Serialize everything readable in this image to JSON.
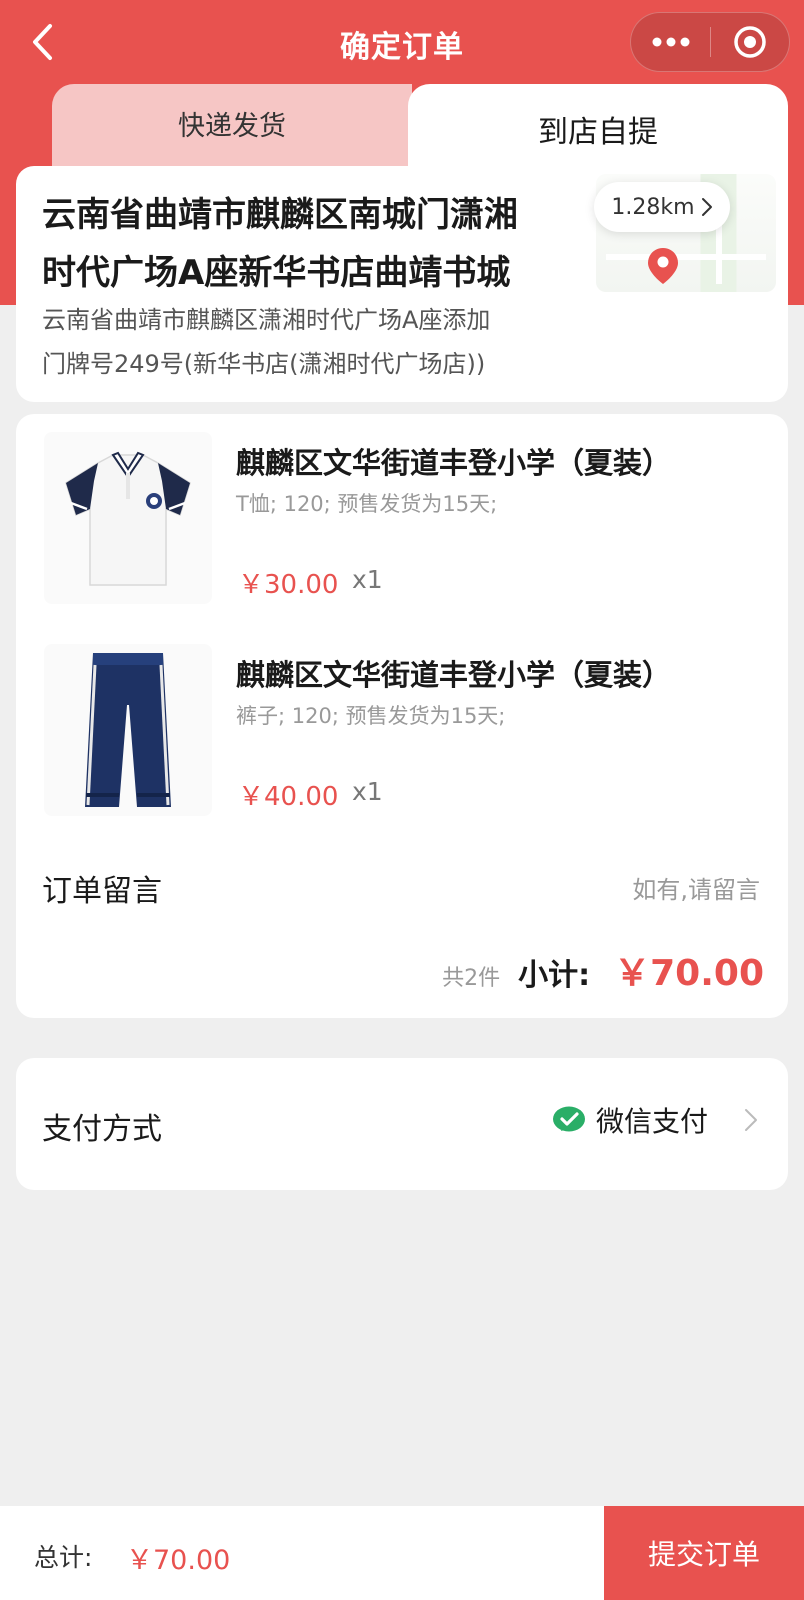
{
  "nav": {
    "title": "确定订单"
  },
  "tabs": [
    {
      "label": "快递发货",
      "active": false
    },
    {
      "label": "到店自提",
      "active": true
    }
  ],
  "store": {
    "name_line1": "云南省曲靖市麒麟区南城门潇湘",
    "name_line2": "时代广场A座新华书店曲靖书城",
    "address_line1": "云南省曲靖市麒麟区潇湘时代广场A座添加",
    "address_line2": "门牌号249号(新华书店(潇湘时代广场店))",
    "distance": "1.28km",
    "distance_icon": "chevron-right-icon"
  },
  "products": [
    {
      "title": "麒麟区文华街道丰登小学（夏装）",
      "spec": "T恤; 120; 预售发货为15天;",
      "price": "￥30.00",
      "qty": "x1",
      "image": "polo-shirt"
    },
    {
      "title": "麒麟区文华街道丰登小学（夏装）",
      "spec": "裤子; 120; 预售发货为15天;",
      "price": "￥40.00",
      "qty": "x1",
      "image": "track-pants"
    }
  ],
  "remark": {
    "label": "订单留言",
    "placeholder": "如有,请留言"
  },
  "subtotal": {
    "count": "共2件",
    "label": "小计:",
    "amount": "￥70.00"
  },
  "payment": {
    "label": "支付方式",
    "method": "微信支付",
    "method_icon": "wechat-pay-icon"
  },
  "footer": {
    "total_label": "总计:",
    "total_amount": "￥70.00",
    "submit_label": "提交订单"
  },
  "colors": {
    "brand": "#e8524f",
    "tab_inactive": "#f6c6c5",
    "wechat": "#2aae67"
  }
}
